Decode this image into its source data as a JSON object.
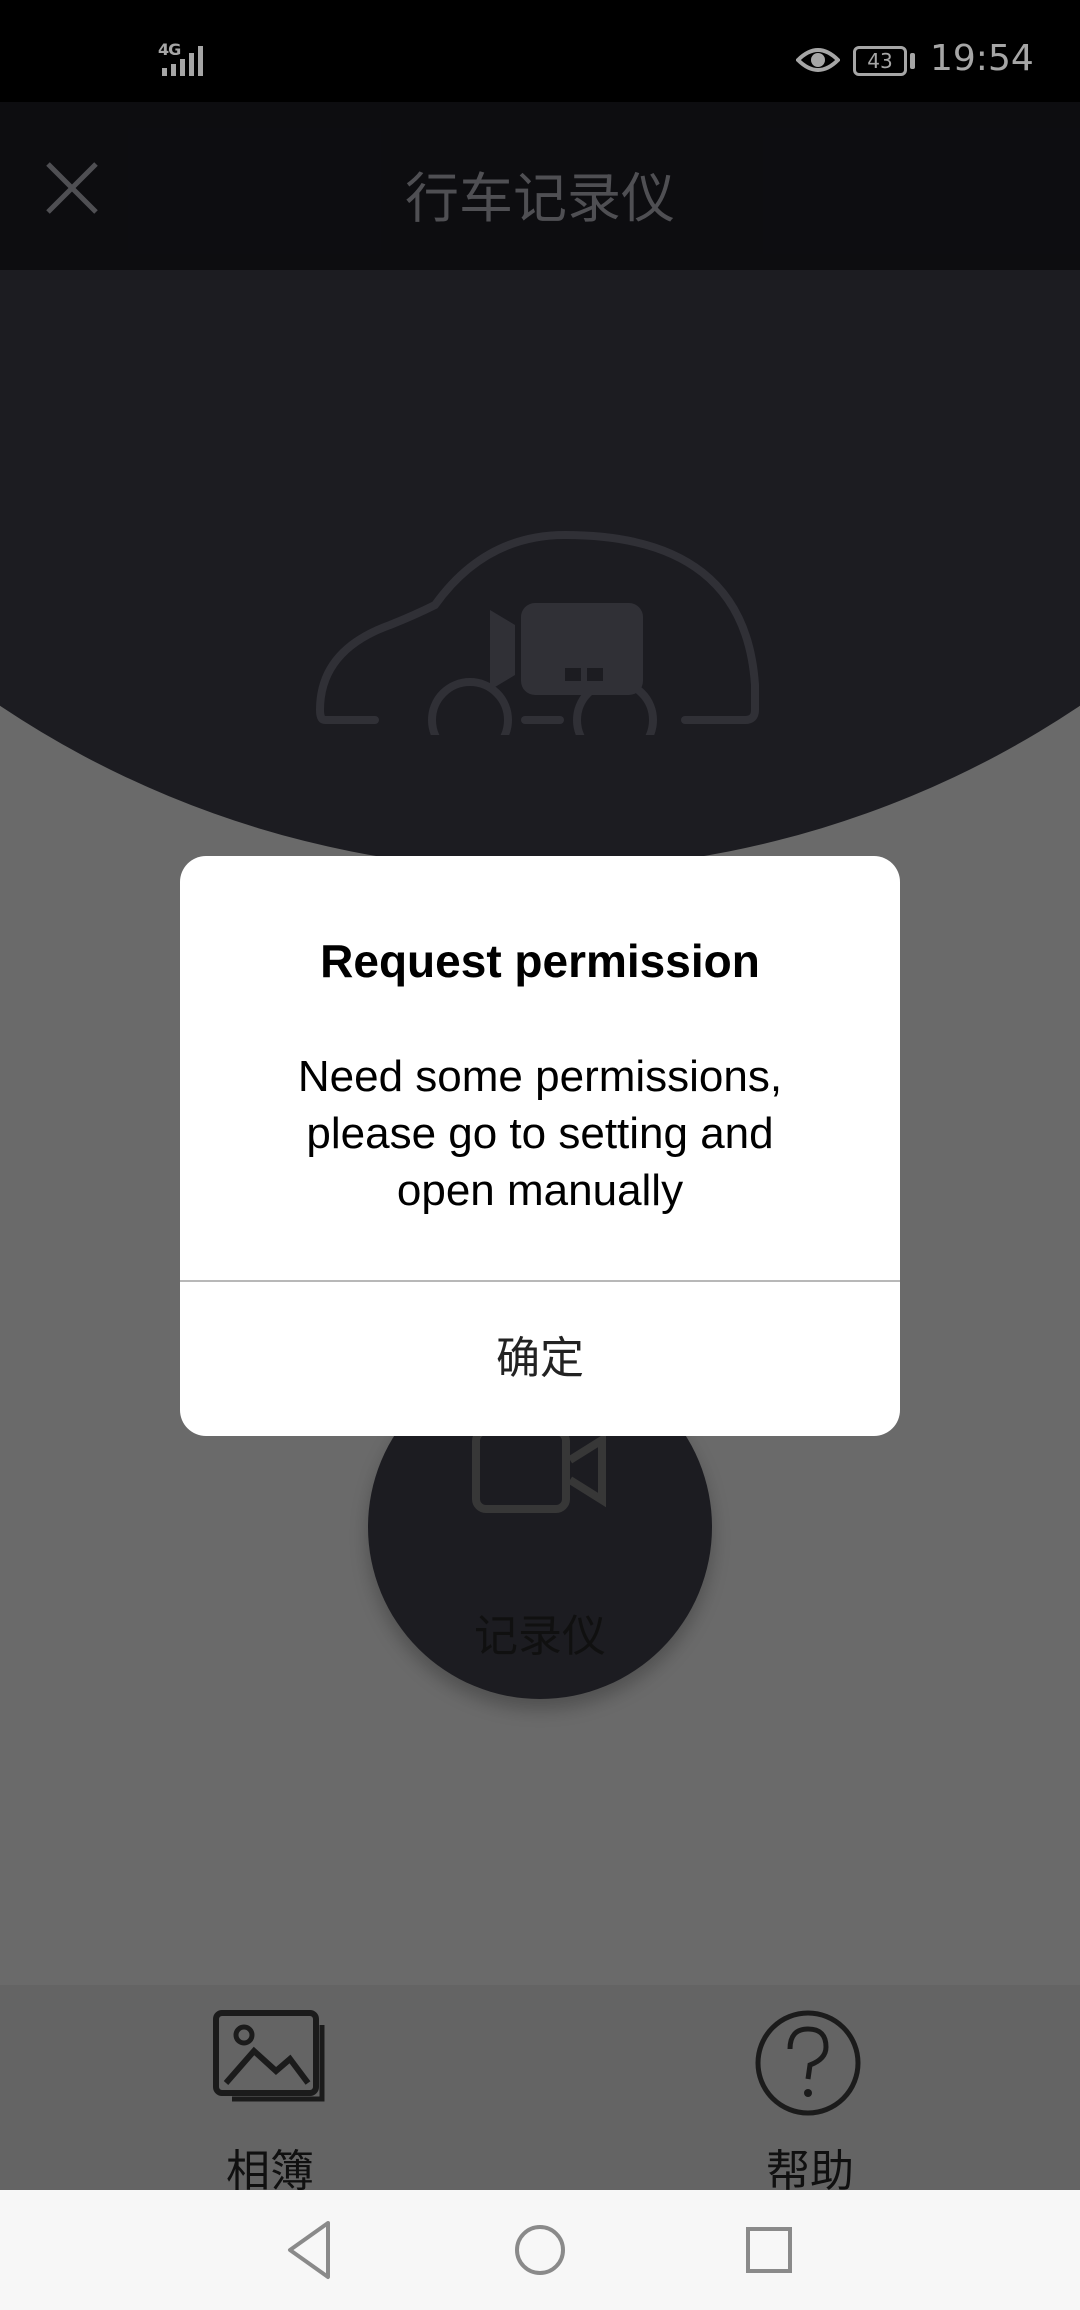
{
  "status_bar": {
    "network": "4G",
    "battery": "43",
    "time": "19:54"
  },
  "header": {
    "title": "行车记录仪"
  },
  "main": {
    "record_label": "记录仪"
  },
  "tabs": [
    {
      "label": "相簿",
      "icon": "image-icon"
    },
    {
      "label": "帮助",
      "icon": "help-icon"
    }
  ],
  "dialog": {
    "title": "Request permission",
    "message_lines": [
      "Need some permissions,",
      "please go to setting and",
      "open manually"
    ],
    "confirm_label": "确定"
  },
  "colors": {
    "dark_surface": "#2b2b33",
    "header_bg": "#14141a",
    "content_bg": "#a3a3a3"
  }
}
